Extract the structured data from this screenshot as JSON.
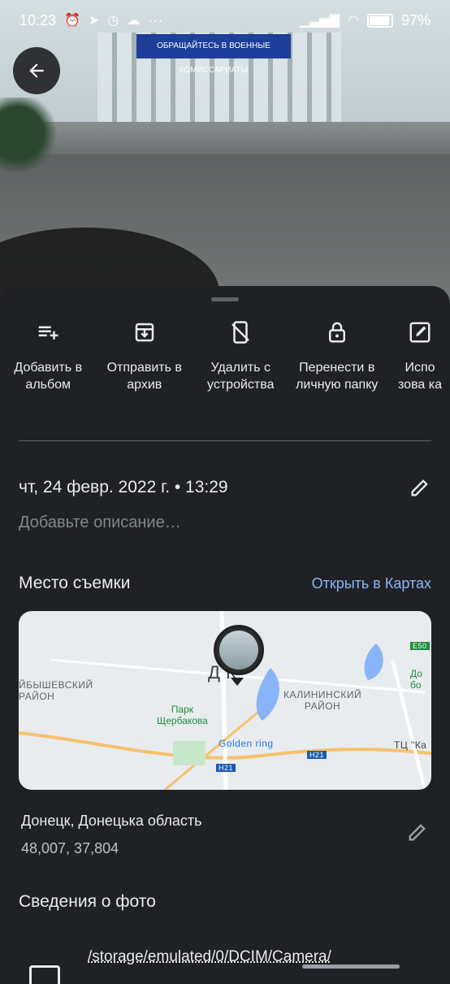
{
  "status_bar": {
    "time": "10:23",
    "dots": "···",
    "battery": "97"
  },
  "photo": {
    "banner_text": "ОБРАЩАЙТЕСЬ В ВОЕННЫЕ КОМИССАРИАТЫ"
  },
  "actions": [
    {
      "label": "Добавить в альбом",
      "icon": "playlist-add-icon"
    },
    {
      "label": "Отправить в архив",
      "icon": "archive-icon"
    },
    {
      "label": "Удалить с устройства",
      "icon": "phone-delete-icon"
    },
    {
      "label": "Перенести в личную папку",
      "icon": "lock-icon"
    },
    {
      "label": "Испо зова ка",
      "icon": "edit-icon"
    }
  ],
  "details": {
    "date": "чт, 24 февр. 2022 г. • 13:29",
    "description_placeholder": "Добавьте описание…"
  },
  "location": {
    "title": "Место съемки",
    "open_maps": "Открыть в Картах",
    "map_labels": {
      "district_left": "ЙБЫШЕВСКИЙ\nРАЙОН",
      "district_right": "КАЛИНИНСКИЙ\nРАЙОН",
      "park": "Парк\nЩербакова",
      "mall": "Golden ring",
      "tc": "ТЦ \"Ка",
      "road1": "H21",
      "road2": "H21",
      "road_e50": "E50",
      "city": "Д    К",
      "garden": "До\nбо"
    },
    "name": "Донецк, Донецька область",
    "coords": "48,007, 37,804"
  },
  "photo_info": {
    "title": "Сведения о фото",
    "path": "/storage/emulated/0/DCIM/Camera/"
  },
  "colors": {
    "accent": "#8ab4f8",
    "sheet_bg": "#202124"
  }
}
